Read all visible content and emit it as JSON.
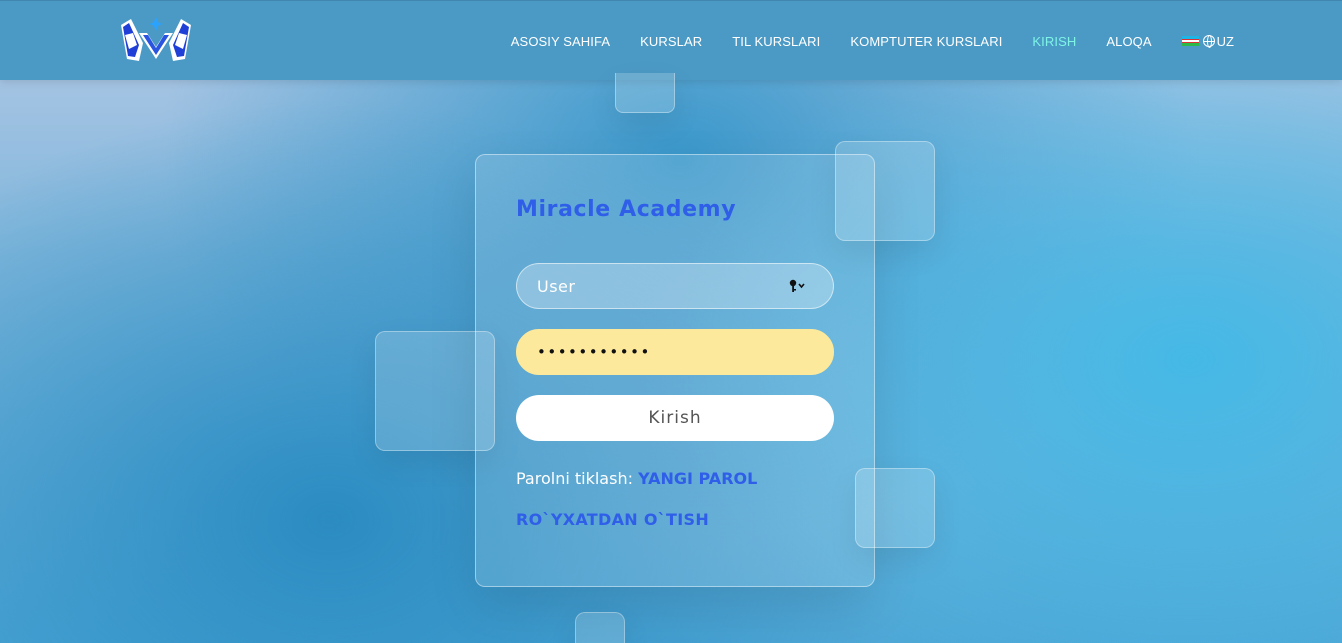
{
  "nav": {
    "items": [
      {
        "label": "ASOSIY SAHIFA",
        "active": false
      },
      {
        "label": "KURSLAR",
        "active": false
      },
      {
        "label": "TIL KURSLARI",
        "active": false
      },
      {
        "label": "KOMPTUTER KURSLARI",
        "active": false
      },
      {
        "label": "KIRISH",
        "active": true
      },
      {
        "label": "ALOQA",
        "active": false
      }
    ],
    "language": "UZ",
    "active_color": "#7ef3e6",
    "bar_color": "#4b9ac5"
  },
  "icons": {
    "logo": "academy-logo-icon",
    "flag": "uzbekistan-flag-icon",
    "globe": "globe-icon",
    "key": "key-icon"
  },
  "login": {
    "brand": "Miracle Academy",
    "username_placeholder": "User",
    "password_value": "•••••••••••",
    "submit_label": "Kirish",
    "reset_prefix": "Parolni tiklash:",
    "reset_link": "YANGI PAROL",
    "register_link": "RO`YXATDAN O`TISH",
    "accent_color": "#2f5ee8"
  }
}
